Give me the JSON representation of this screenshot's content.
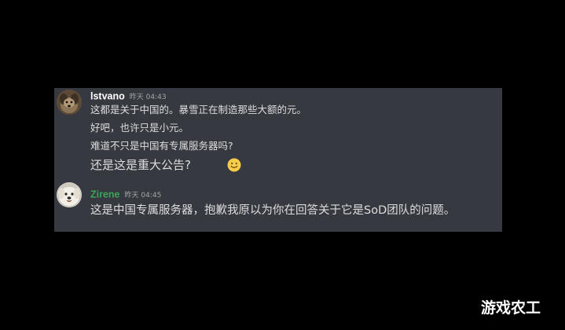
{
  "messages": [
    {
      "username": "lstvano",
      "timestamp": "昨天 04:43",
      "lines": [
        "这都是关于中国的。暴雪正在制造那些大额的元。",
        "好吧，也许只是小元。",
        "难道不只是中国有专属服务器吗?",
        "还是这是重大公告?"
      ],
      "emoji": "slightly-smiling-face-icon"
    },
    {
      "username": "Zirene",
      "timestamp": "昨天 04:45",
      "lines": [
        "这是中国专属服务器，抱歉我原以为你在回答关于它是SoD团队的问题。"
      ]
    }
  ],
  "colors": {
    "background": "#000000",
    "chat_panel": "#36393f",
    "message_text": "#dcddde",
    "username_1": "#ffffff",
    "username_2": "#3ba55c",
    "timestamp": "#a3a6aa"
  },
  "watermark": "游戏农工"
}
